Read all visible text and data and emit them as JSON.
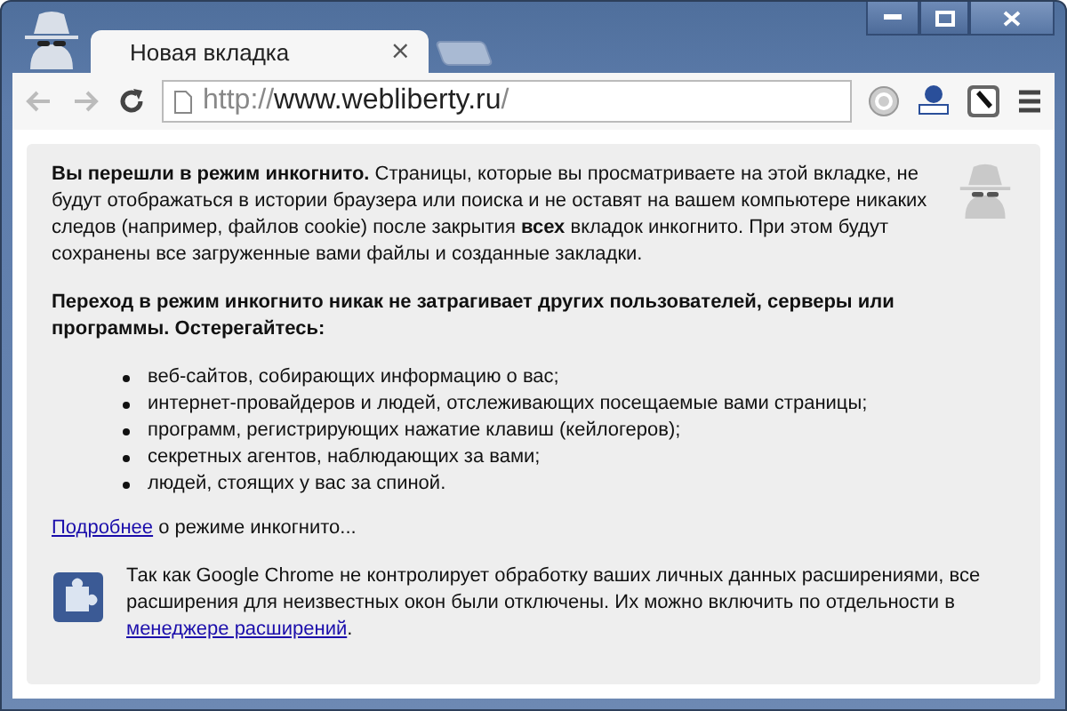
{
  "tabs": [
    {
      "title": "Новая вкладка",
      "close": "×",
      "selected": true
    }
  ],
  "toolbar": {
    "back": {
      "disabled": true
    },
    "forward": {
      "disabled": true
    },
    "url": {
      "scheme": "http://",
      "host": "www.webliberty.ru",
      "path": "/"
    }
  },
  "intro": "**Вы перешли в режим инкогнито.** Страницы, которые вы просматриваете на этой вкладке, не будут отображаться в истории браузера или поиска и не оставят на вашем компьютере никаких следов (например, файлов cookie) после закрытия **всех** вкладок инкогнито. При этом будут сохранены все загруженные вами файлы и созданные закладки.",
  "warning": "Переход в режим инкогнито никак не затрагивает других пользователей, серверы или программы. Остерегайтесь:",
  "bullets": [
    "веб-сайтов, собирающих информацию о вас;",
    "интернет-провайдеров и людей, отслеживающих посещаемые вами страницы;",
    "программ, регистрирующих нажатие клавиш (кейлогеров);",
    "секретных агентов, наблюдающих за вами;",
    "людей, стоящих у вас за спиной."
  ],
  "more": {
    "link": "Подробнее",
    "text": " о режиме инкогнито..."
  },
  "extensions_note": {
    "text": "Так как Google Chrome не контролирует обработку ваших личных данных расширениями, все расширения для неизвестных окон были отключены. Их можно включить по отдельности в ",
    "link": "менеджере расширений",
    "after": "."
  }
}
